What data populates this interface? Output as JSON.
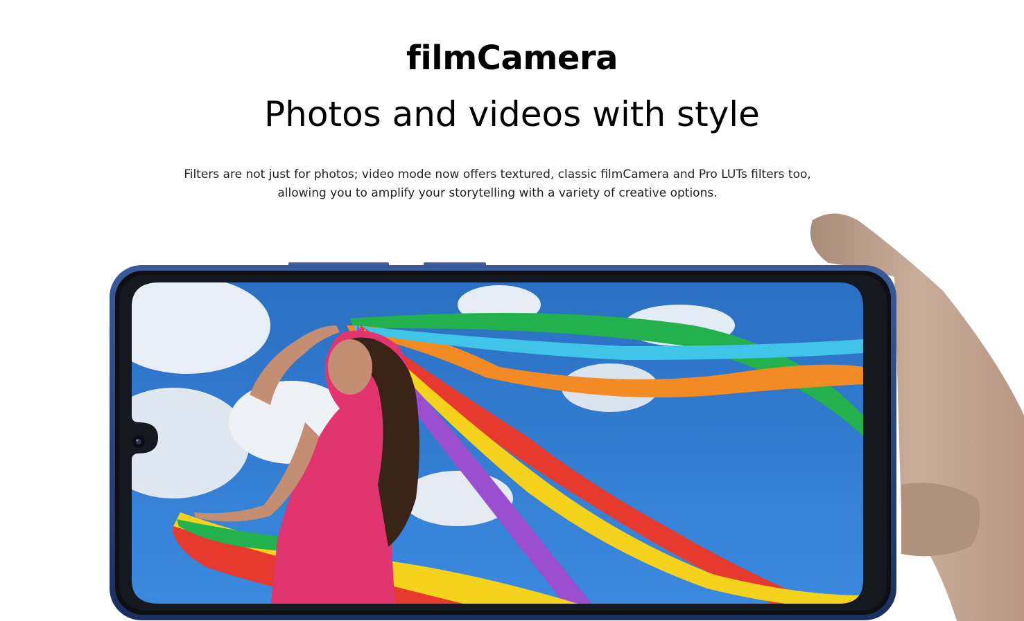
{
  "section": {
    "title": "filmCamera",
    "subtitle": "Photos and videos with style",
    "description": "Filters are not just for photos; video mode now offers textured, classic filmCamera and Pro LUTs filters too, allowing you to amplify your storytelling with a variety of creative options."
  },
  "hero_image": {
    "icons": [
      "phone-image",
      "hand-image",
      "front-camera-icon",
      "ribbon-photo"
    ]
  },
  "colors": {
    "background": "#ffffff",
    "text": "#000000",
    "phone_frame": "#1c2a4a",
    "sky": "#2f7fd0"
  }
}
